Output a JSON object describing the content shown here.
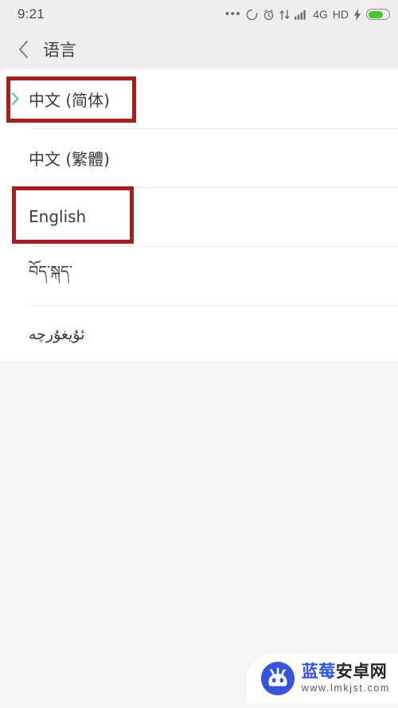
{
  "status_bar": {
    "time": "9:21",
    "network_type": "4G",
    "hd_label": "HD",
    "icons": [
      "more-dots-icon",
      "sync-circle-icon",
      "alarm-clock-icon",
      "data-transfer-icon",
      "signal-bars-icon"
    ],
    "battery_level_percent": 74,
    "battery_charging": true,
    "colors": {
      "background": "#EFEDF0",
      "text": "#4a4a4a",
      "battery_fill": "#49C628"
    }
  },
  "app_bar": {
    "back_icon": "chevron-left-icon",
    "title": "语言",
    "background": "#EFEDF0"
  },
  "language_list": {
    "items": [
      {
        "label": "中文 (简体)",
        "selected": true,
        "direction": "ltr",
        "marker": "chevron-right-icon"
      },
      {
        "label": "中文 (繁體)",
        "selected": false,
        "direction": "ltr",
        "marker": ""
      },
      {
        "label": "English",
        "selected": false,
        "direction": "ltr",
        "marker": ""
      },
      {
        "label": "བོད་སྐད་",
        "selected": false,
        "direction": "ltr",
        "marker": ""
      },
      {
        "label": "ئۇيغۇرچە",
        "selected": false,
        "direction": "rtl",
        "marker": ""
      }
    ],
    "selected_marker_color": "#4FC3D9",
    "background": "#FFFFFF",
    "divider_color": "#EDEDED"
  },
  "annotations": {
    "color": "#A41F22",
    "boxes": [
      {
        "name": "highlight-simplified-chinese",
        "target": "中文 (简体)"
      },
      {
        "name": "highlight-english",
        "target": "English"
      }
    ]
  },
  "watermark": {
    "brand_primary": "蓝莓",
    "brand_secondary": "安卓网",
    "url": "www.lmkjst.com",
    "logo_icon": "android-robot-icon",
    "brand_color": "#3355DD",
    "secondary_color": "#23262E"
  },
  "page_background": "#F7F5F8"
}
